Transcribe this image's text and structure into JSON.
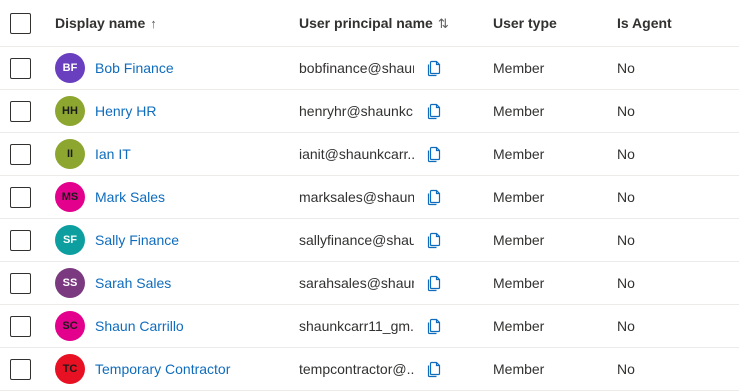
{
  "header": {
    "display_name": "Display name",
    "display_name_sort": "↑",
    "upn": "User principal name",
    "upn_sort": "⇅",
    "user_type": "User type",
    "is_agent": "Is Agent"
  },
  "rows": [
    {
      "initials": "BF",
      "avatar_color": "#6a3fbf",
      "initials_color": "#ffffff",
      "name": "Bob Finance",
      "upn": "bobfinance@shaun...",
      "type": "Member",
      "agent": "No"
    },
    {
      "initials": "HH",
      "avatar_color": "#8ca62f",
      "initials_color": "#1b1b1b",
      "name": "Henry HR",
      "upn": "henryhr@shaunkc...",
      "type": "Member",
      "agent": "No"
    },
    {
      "initials": "II",
      "avatar_color": "#8ca62f",
      "initials_color": "#1b1b1b",
      "name": "Ian IT",
      "upn": "ianit@shaunkcarr...",
      "type": "Member",
      "agent": "No"
    },
    {
      "initials": "MS",
      "avatar_color": "#e3008c",
      "initials_color": "#1b1b1b",
      "name": "Mark Sales",
      "upn": "marksales@shaun...",
      "type": "Member",
      "agent": "No"
    },
    {
      "initials": "SF",
      "avatar_color": "#0d9f9f",
      "initials_color": "#ffffff",
      "name": "Sally Finance",
      "upn": "sallyfinance@shau...",
      "type": "Member",
      "agent": "No"
    },
    {
      "initials": "SS",
      "avatar_color": "#7b3a80",
      "initials_color": "#ffffff",
      "name": "Sarah Sales",
      "upn": "sarahsales@shaun...",
      "type": "Member",
      "agent": "No"
    },
    {
      "initials": "SC",
      "avatar_color": "#e3008c",
      "initials_color": "#1b1b1b",
      "name": "Shaun Carrillo",
      "upn": "shaunkcarr11_gm...",
      "type": "Member",
      "agent": "No"
    },
    {
      "initials": "TC",
      "avatar_color": "#e81123",
      "initials_color": "#1b1b1b",
      "name": "Temporary Contractor",
      "upn": "tempcontractor@...",
      "type": "Member",
      "agent": "No"
    }
  ]
}
